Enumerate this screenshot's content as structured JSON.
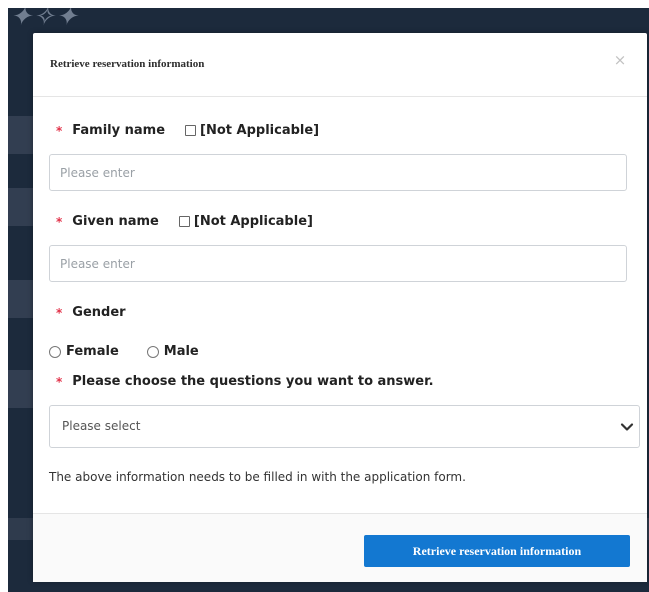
{
  "modal": {
    "title": "Retrieve reservation information",
    "close_label": "×"
  },
  "form": {
    "required_mark": "*",
    "family_name": {
      "label": "Family name",
      "not_applicable_label": "[Not Applicable]",
      "placeholder": "Please enter",
      "value": ""
    },
    "given_name": {
      "label": "Given name",
      "not_applicable_label": "[Not Applicable]",
      "placeholder": "Please enter",
      "value": ""
    },
    "gender": {
      "label": "Gender",
      "options": [
        "Female",
        "Male"
      ],
      "selected": null
    },
    "question": {
      "label": "Please choose the questions you want to answer.",
      "selected_text": "Please select"
    },
    "note": "The above information needs to be filled in with the application form."
  },
  "footer": {
    "submit_label": "Retrieve reservation information"
  },
  "colors": {
    "accent": "#1378d1",
    "required": "#e2334a",
    "backdrop": "#1c2a3c"
  },
  "icons": {
    "close": "close-icon",
    "select_arrow": "chevron-down-icon"
  }
}
